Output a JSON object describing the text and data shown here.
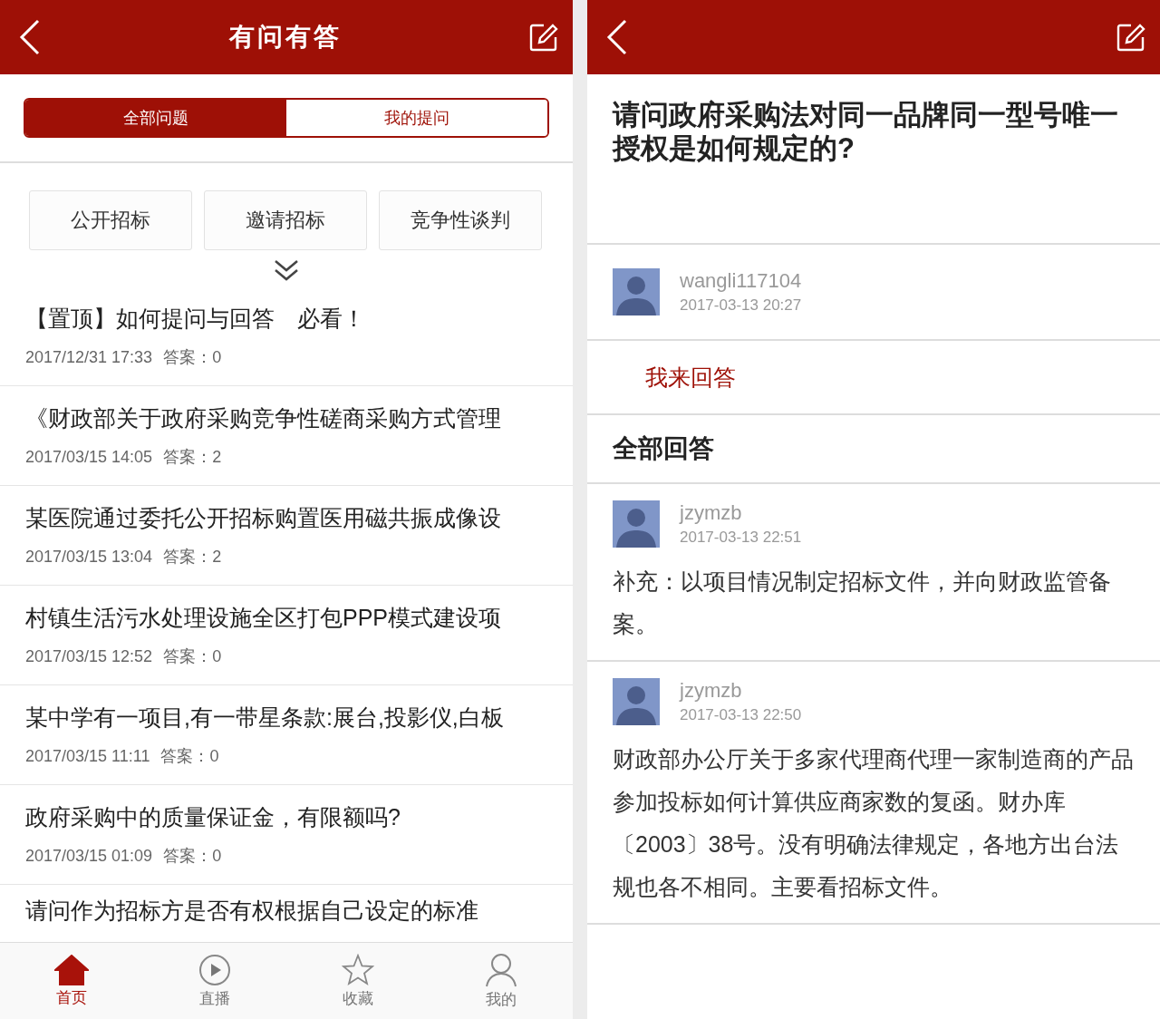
{
  "left": {
    "header": {
      "title": "有问有答"
    },
    "tabs": [
      {
        "label": "全部问题",
        "selected": true
      },
      {
        "label": "我的提问",
        "selected": false
      }
    ],
    "categories": [
      "公开招标",
      "邀请招标",
      "竞争性谈判"
    ],
    "questions": [
      {
        "title": "【置顶】如何提问与回答　必看！",
        "date": "2017/12/31 17:33",
        "answers_label": "答案：",
        "answers": "0"
      },
      {
        "title": "《财政部关于政府采购竞争性磋商采购方式管理",
        "date": "2017/03/15 14:05",
        "answers_label": "答案：",
        "answers": "2"
      },
      {
        "title": "某医院通过委托公开招标购置医用磁共振成像设",
        "date": "2017/03/15 13:04",
        "answers_label": "答案：",
        "answers": "2"
      },
      {
        "title": "村镇生活污水处理设施全区打包PPP模式建设项",
        "date": "2017/03/15 12:52",
        "answers_label": "答案：",
        "answers": "0"
      },
      {
        "title": "某中学有一项目,有一带星条款:展台,投影仪,白板",
        "date": "2017/03/15 11:11",
        "answers_label": "答案：",
        "answers": "0"
      },
      {
        "title": "政府采购中的质量保证金，有限额吗?",
        "date": "2017/03/15 01:09",
        "answers_label": "答案：",
        "answers": "0"
      },
      {
        "title": "请问作为招标方是否有权根据自己设定的标准"
      }
    ],
    "nav": [
      {
        "label": "首页",
        "kind": "home",
        "selected": true
      },
      {
        "label": "直播",
        "kind": "play",
        "selected": false
      },
      {
        "label": "收藏",
        "kind": "star",
        "selected": false
      },
      {
        "label": "我的",
        "kind": "person",
        "selected": false
      }
    ]
  },
  "right": {
    "question": "请问政府采购法对同一品牌同一型号唯一授权是如何规定的?",
    "asker": {
      "name": "wangli117104",
      "time": "2017-03-13 20:27"
    },
    "answer_button": "我来回答",
    "answers_heading": "全部回答",
    "answers": [
      {
        "name": "jzymzb",
        "time": "2017-03-13 22:51",
        "text": "补充：以项目情况制定招标文件，并向财政监管备案。"
      },
      {
        "name": "jzymzb",
        "time": "2017-03-13 22:50",
        "text": "财政部办公厅关于多家代理商代理一家制造商的产品参加投标如何计算供应商家数的复函。财办库〔2003〕38号。没有明确法律规定，各地方出台法规也各不相同。主要看招标文件。"
      }
    ]
  }
}
